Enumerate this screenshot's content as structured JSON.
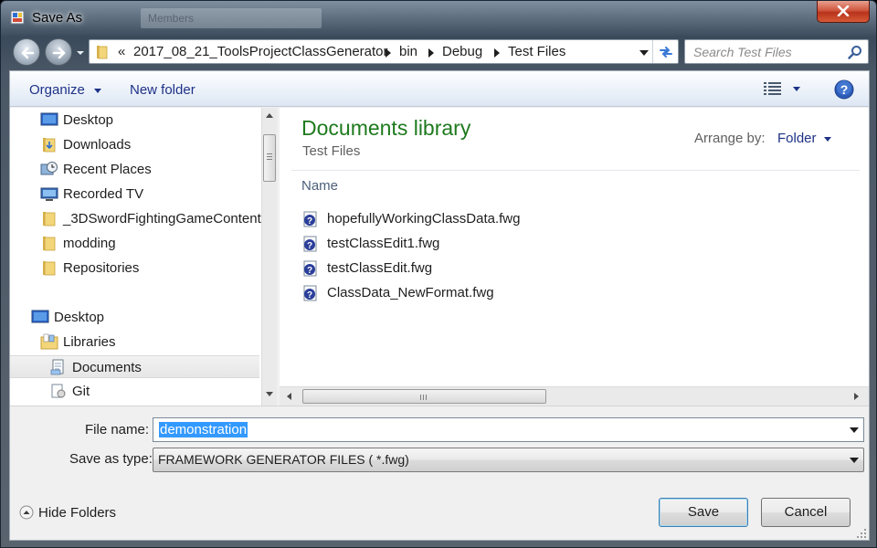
{
  "window": {
    "title": "Save As",
    "ghost_tab": "Members"
  },
  "address_bar": {
    "overflow": "«",
    "crumbs": [
      "2017_08_21_ToolsProjectClassGenerator",
      "bin",
      "Debug",
      "Test Files"
    ]
  },
  "search": {
    "placeholder": "Search Test Files"
  },
  "toolbar": {
    "organize": "Organize",
    "new_folder": "New folder"
  },
  "nav_pane": {
    "items": [
      {
        "label": "Desktop",
        "icon": "desktop-icon"
      },
      {
        "label": "Downloads",
        "icon": "downloads-folder-icon"
      },
      {
        "label": "Recent Places",
        "icon": "recent-places-icon"
      },
      {
        "label": "Recorded TV",
        "icon": "recorded-tv-icon"
      },
      {
        "label": "_3DSwordFightingGameContent",
        "icon": "folder-icon"
      },
      {
        "label": "modding",
        "icon": "folder-icon"
      },
      {
        "label": "Repositories",
        "icon": "folder-icon"
      },
      {
        "label": "Desktop",
        "icon": "desktop-icon"
      },
      {
        "label": "Libraries",
        "icon": "libraries-icon"
      },
      {
        "label": "Documents",
        "icon": "documents-icon"
      },
      {
        "label": "Git",
        "icon": "git-icon"
      }
    ],
    "selected_index": 9
  },
  "content": {
    "title": "Documents library",
    "subtitle": "Test Files",
    "arrange_label": "Arrange by:",
    "arrange_value": "Folder",
    "column_name": "Name",
    "files": [
      "hopefullyWorkingClassData.fwg",
      "testClassEdit1.fwg",
      "testClassEdit.fwg",
      "ClassData_NewFormat.fwg"
    ]
  },
  "form": {
    "filename_label": "File name:",
    "filename_value": "demonstration",
    "filetype_label": "Save as type:",
    "filetype_value": "FRAMEWORK GENERATOR FILES  ( *.fwg)",
    "hide_folders": "Hide Folders",
    "save": "Save",
    "cancel": "Cancel"
  },
  "colors": {
    "library_title": "#1e7a1e",
    "link_blue": "#1e3287",
    "selection": "#3399ff",
    "close_red": "#c7432a"
  }
}
